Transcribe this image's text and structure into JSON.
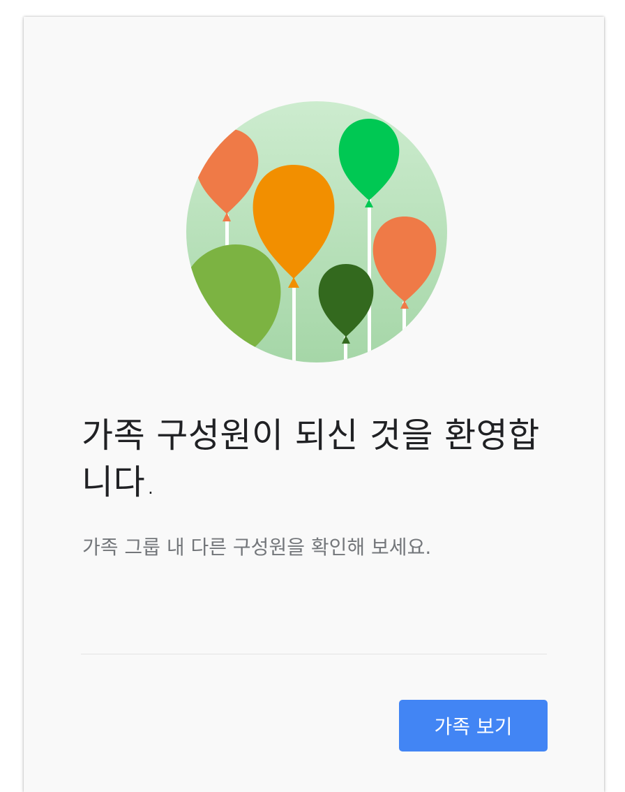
{
  "welcome_card": {
    "illustration_icon": "balloons-illustration",
    "title": "가족 구성원이 되신 것을 환영합니다.",
    "subtitle": "가족 그룹 내 다른 구성원을 확인해 보세요.",
    "view_family_button_label": "가족 보기",
    "colors": {
      "card_background": "#f9f9f9",
      "button": "#4285f4",
      "circle_background": "#c3e6c7",
      "balloon_orange_red": "#ef7a47",
      "balloon_orange": "#f28f00",
      "balloon_bright_green": "#00c853",
      "balloon_light_green": "#7cb342",
      "balloon_dark_green": "#33691e"
    }
  }
}
